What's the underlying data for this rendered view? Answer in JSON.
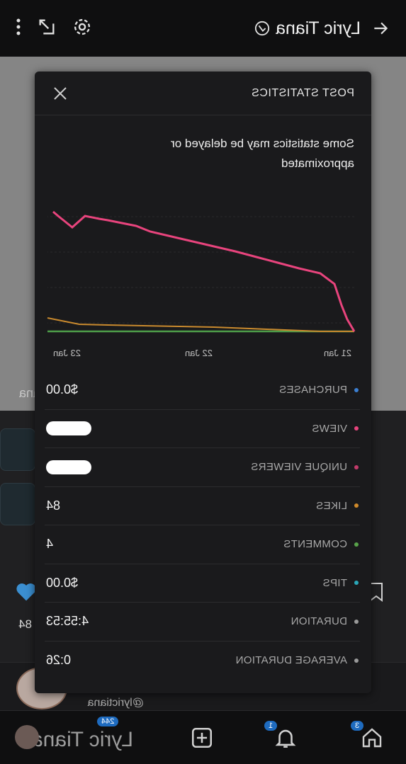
{
  "header": {
    "title": "Lyric Tiana"
  },
  "background": {
    "name_fragment": "iana",
    "like_count": "84",
    "handle": "@lyrictiana"
  },
  "bottom_nav": {
    "home_badge": "3",
    "notif_badge": "1",
    "messages_badge": "244",
    "user_name": "Lyric Tiana"
  },
  "modal": {
    "title": "POST STATISTICS",
    "notice": "Some statistics may be delayed or approximated",
    "x_ticks": [
      "21 Jan",
      "22 Jan",
      "23 Jan"
    ],
    "stats": [
      {
        "label": "PURCHASES",
        "value": "$0.00",
        "color": "#3b7fd1"
      },
      {
        "label": "VIEWS",
        "value": "",
        "color": "#e8447d",
        "redacted": true
      },
      {
        "label": "UNIQUE VIEWERS",
        "value": "",
        "color": "#c23b6a",
        "redacted": true
      },
      {
        "label": "LIKES",
        "value": "84",
        "color": "#d08a2a"
      },
      {
        "label": "COMMENTS",
        "value": "4",
        "color": "#58a34a"
      },
      {
        "label": "TIPS",
        "value": "$0.00",
        "color": "#2aa7b8"
      },
      {
        "label": "DURATION",
        "value": "4:55:53",
        "color": "#9a9a9a"
      },
      {
        "label": "AVERAGE DURATION",
        "value": "0:26",
        "color": "#9a9a9a"
      }
    ]
  },
  "colors": {
    "views": "#e8447d",
    "likes": "#c98a2e",
    "comments": "#4fa04a",
    "accent": "#1e6bbf"
  },
  "chart_data": {
    "type": "line",
    "x": [
      "21 Jan",
      "22 Jan",
      "23 Jan"
    ],
    "series": [],
    "grid": true
  }
}
